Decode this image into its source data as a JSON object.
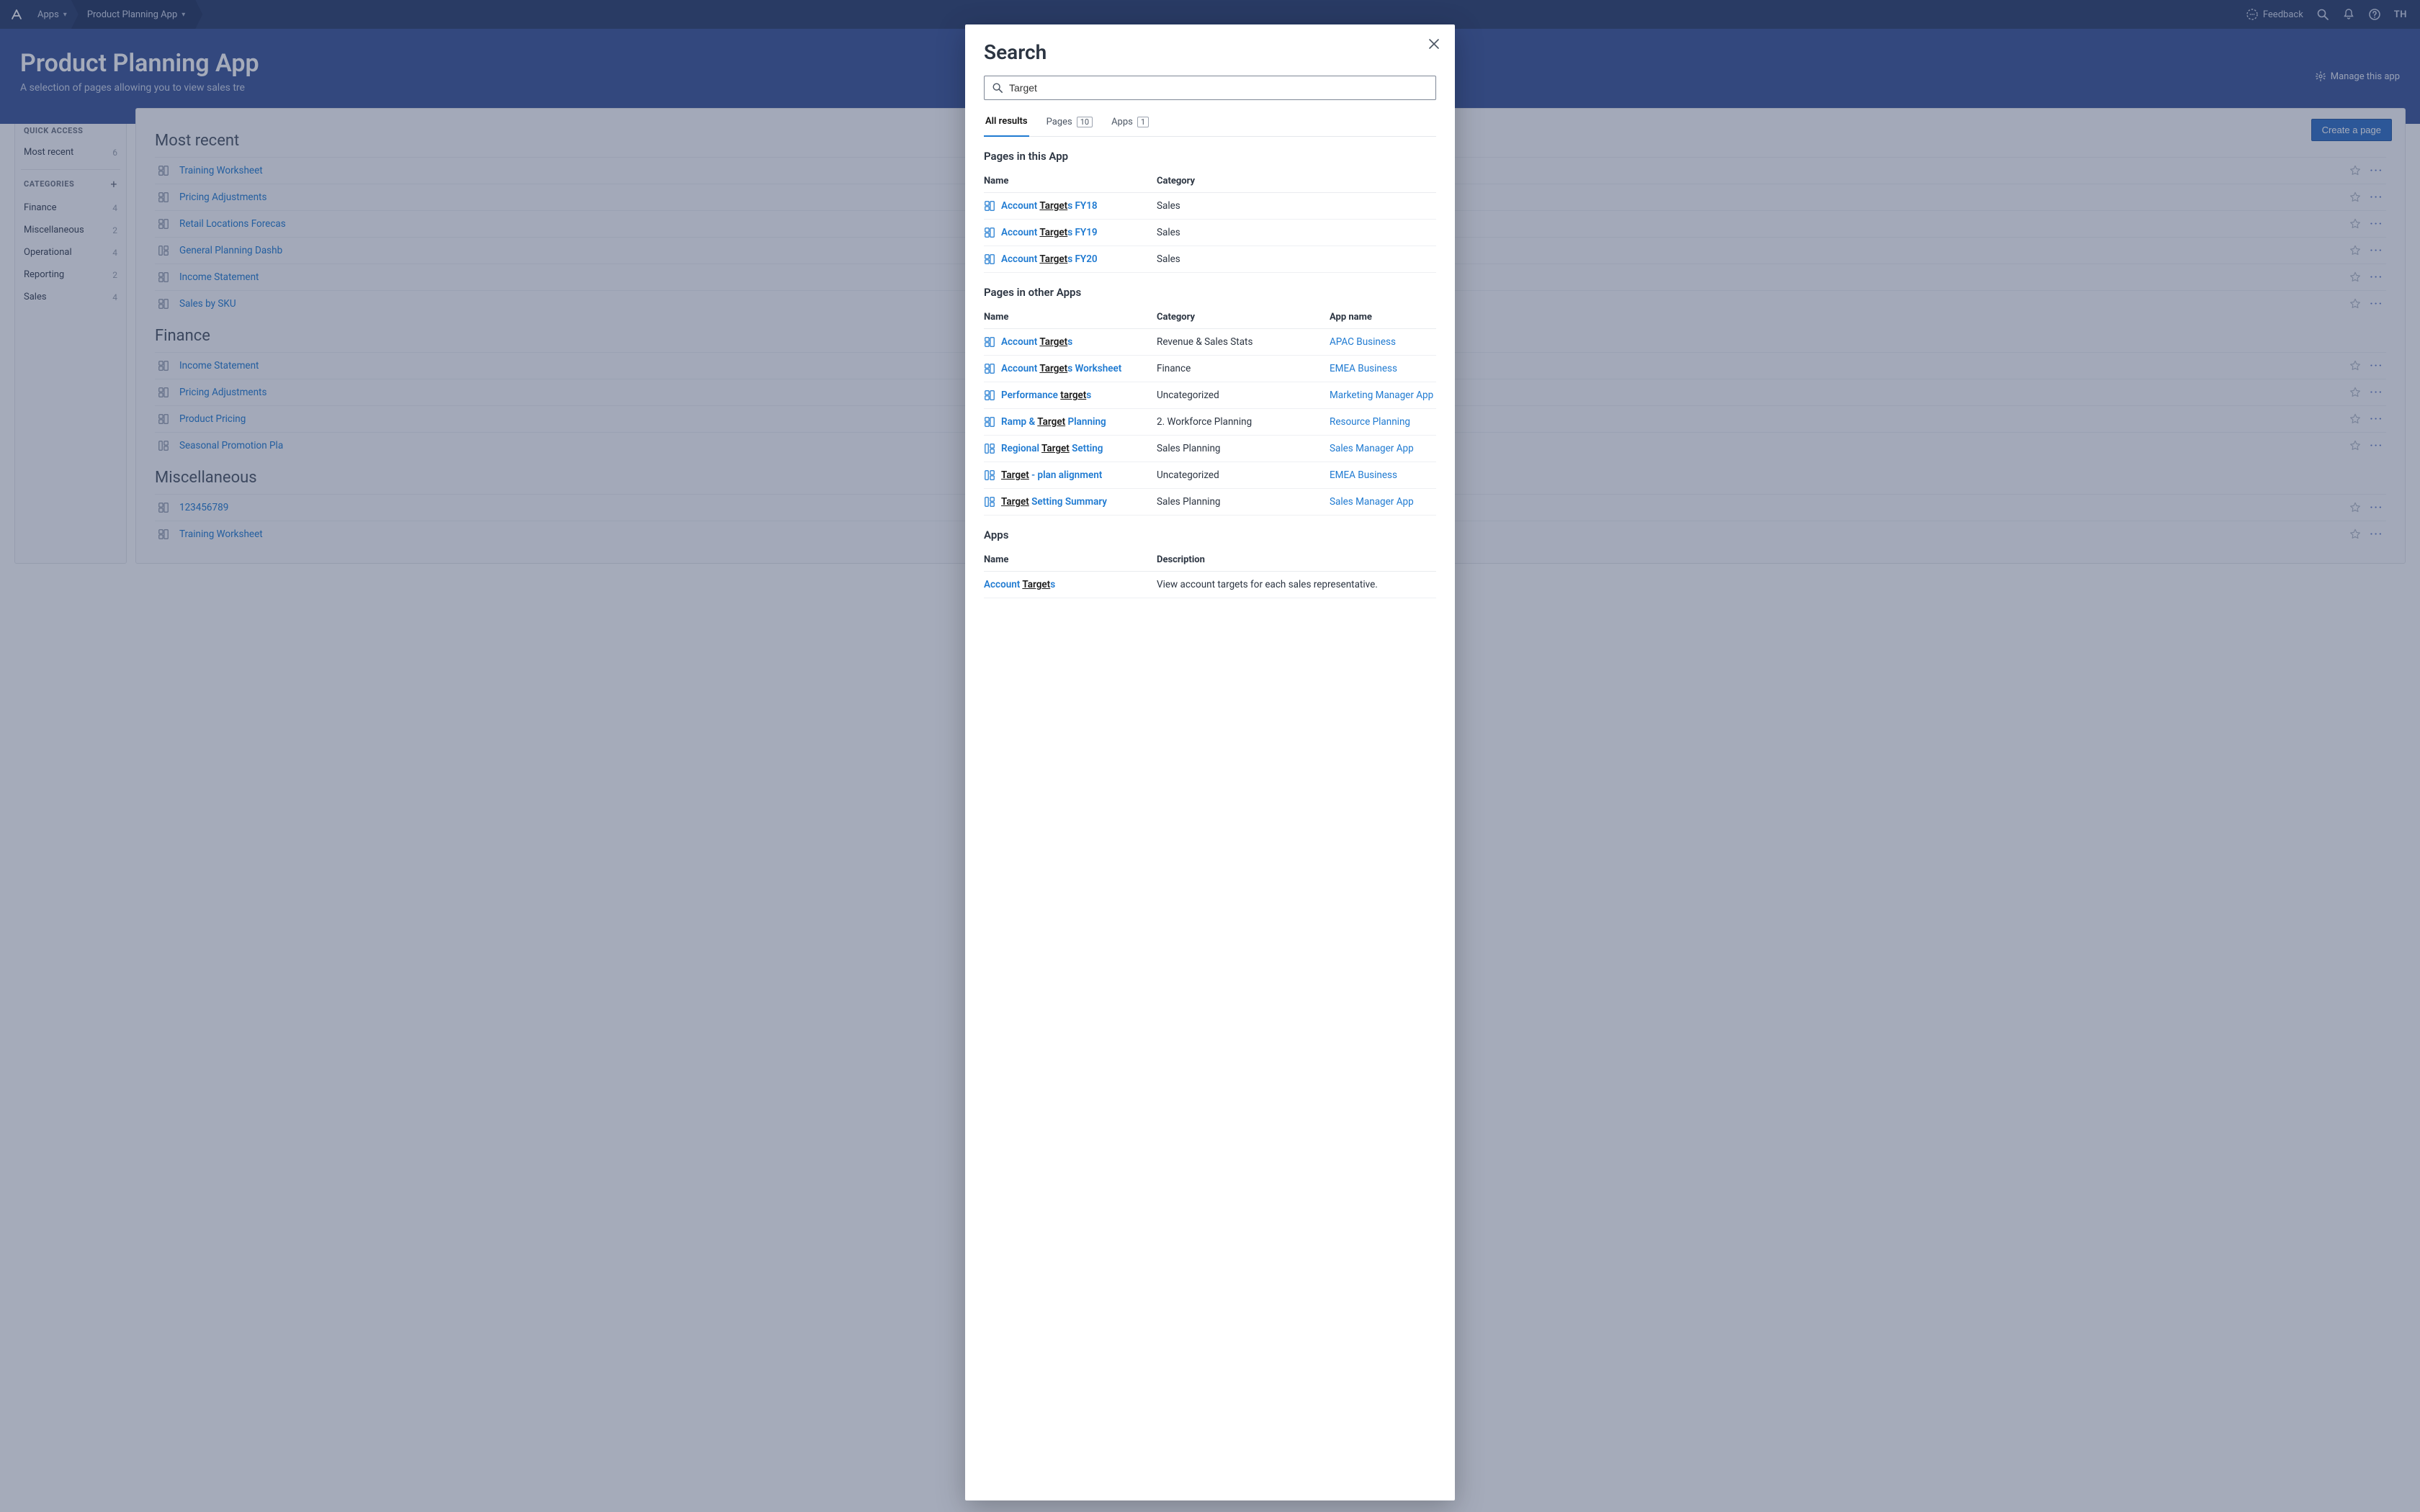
{
  "topbar": {
    "apps_label": "Apps",
    "breadcrumb": "Product Planning App",
    "feedback": "Feedback",
    "avatar": "TH"
  },
  "hero": {
    "title": "Product Planning App",
    "subtitle": "A selection of pages allowing you to view sales tre",
    "manage": "Manage this app"
  },
  "sidebar": {
    "quick_access_label": "QUICK ACCESS",
    "most_recent": {
      "label": "Most recent",
      "count": "6"
    },
    "categories_label": "CATEGORIES",
    "items": [
      {
        "label": "Finance",
        "count": "4"
      },
      {
        "label": "Miscellaneous",
        "count": "2"
      },
      {
        "label": "Operational",
        "count": "4"
      },
      {
        "label": "Reporting",
        "count": "2"
      },
      {
        "label": "Sales",
        "count": "4"
      }
    ]
  },
  "main": {
    "create_label": "Create a page",
    "sections": [
      {
        "heading": "Most recent",
        "rows": [
          {
            "title": "Training Worksheet",
            "icon": "worksheet"
          },
          {
            "title": "Pricing Adjustments",
            "icon": "worksheet"
          },
          {
            "title": "Retail Locations Forecas",
            "icon": "worksheet"
          },
          {
            "title": "General Planning Dashb",
            "icon": "board"
          },
          {
            "title": "Income Statement",
            "icon": "worksheet"
          },
          {
            "title": "Sales by SKU",
            "icon": "worksheet"
          }
        ]
      },
      {
        "heading": "Finance",
        "rows": [
          {
            "title": "Income Statement",
            "icon": "worksheet"
          },
          {
            "title": "Pricing Adjustments",
            "icon": "worksheet"
          },
          {
            "title": "Product Pricing",
            "icon": "worksheet"
          },
          {
            "title": "Seasonal Promotion Pla",
            "icon": "board"
          }
        ]
      },
      {
        "heading": "Miscellaneous",
        "rows": [
          {
            "title": "123456789",
            "icon": "worksheet"
          },
          {
            "title": "Training Worksheet",
            "icon": "worksheet"
          }
        ]
      }
    ]
  },
  "modal": {
    "title": "Search",
    "query": "Target",
    "tabs": {
      "all": "All results",
      "pages_label": "Pages",
      "pages_count": "10",
      "apps_label": "Apps",
      "apps_count": "1"
    },
    "section_this_app": "Pages in this App",
    "section_other_apps": "Pages in other Apps",
    "section_apps": "Apps",
    "headers": {
      "name": "Name",
      "category": "Category",
      "app_name": "App name",
      "description": "Description"
    },
    "this_app": [
      {
        "pre": "Account ",
        "match": "Target",
        "post": "s FY18",
        "category": "Sales",
        "icon": "worksheet"
      },
      {
        "pre": "Account ",
        "match": "Target",
        "post": "s FY19",
        "category": "Sales",
        "icon": "worksheet"
      },
      {
        "pre": "Account ",
        "match": "Target",
        "post": "s FY20",
        "category": "Sales",
        "icon": "worksheet"
      }
    ],
    "other_apps": [
      {
        "pre": "Account ",
        "match": "Target",
        "post": "s",
        "category": "Revenue & Sales Stats",
        "app": "APAC Business",
        "icon": "worksheet"
      },
      {
        "pre": "Account ",
        "match": "Target",
        "post": "s Worksheet",
        "category": "Finance",
        "app": "EMEA Business",
        "icon": "worksheet"
      },
      {
        "pre": "Performance ",
        "match": "target",
        "post": "s",
        "category": "Uncategorized",
        "app": "Marketing Manager App",
        "icon": "worksheet"
      },
      {
        "pre": "Ramp & ",
        "match": "Target",
        "post": " Planning",
        "category": "2. Workforce Planning",
        "app": "Resource Planning",
        "icon": "worksheet"
      },
      {
        "pre": "Regional ",
        "match": "Target",
        "post": " Setting",
        "category": "Sales Planning",
        "app": "Sales Manager App",
        "icon": "board"
      },
      {
        "pre": "",
        "match": "Target",
        "post": " - plan alignment",
        "category": "Uncategorized",
        "app": "EMEA Business",
        "icon": "board"
      },
      {
        "pre": "",
        "match": "Target",
        "post": " Setting Summary",
        "category": "Sales Planning",
        "app": "Sales Manager App",
        "icon": "board"
      }
    ],
    "apps": [
      {
        "pre": "Account ",
        "match": "Target",
        "post": "s",
        "description": "View account targets for each sales representative."
      }
    ]
  }
}
